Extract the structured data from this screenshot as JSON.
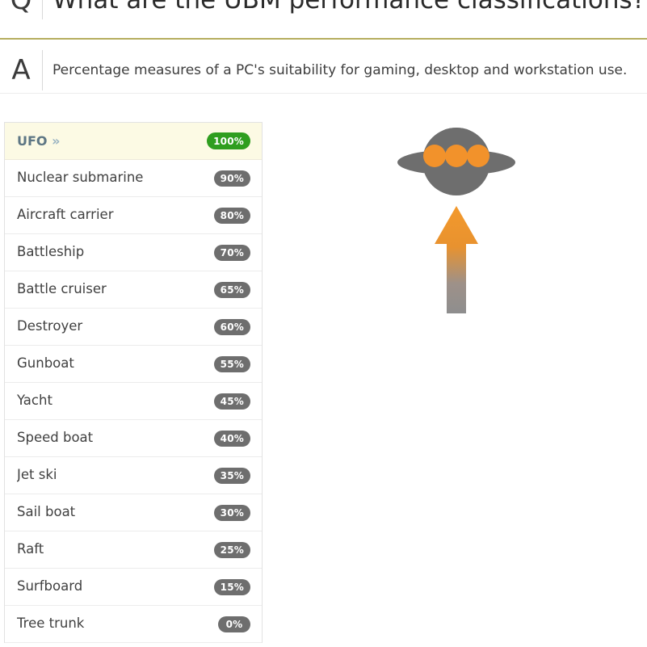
{
  "qa": {
    "question_marker": "Q",
    "question": "What are the UBM performance classifications?",
    "answer_marker": "A",
    "answer": "Percentage measures of a PC's suitability for gaming, desktop and workstation use."
  },
  "colors": {
    "gold_rule": "#b5ad5e",
    "gray_rule": "#ededed",
    "badge_gray": "#6e6e6e",
    "badge_green": "#2f9e1f",
    "highlight_bg": "#fcfae4",
    "highlight_text": "#5d7684",
    "ufo_body": "#6e6e6e",
    "ufo_light": "#f2922b",
    "arrow_top": "#f0982f",
    "arrow_bottom": "#8c8c8c"
  },
  "ranking": {
    "rows": [
      {
        "label": "UFO",
        "chevron": "»",
        "value": "100%",
        "highlight": true
      },
      {
        "label": "Nuclear submarine",
        "chevron": "",
        "value": "90%",
        "highlight": false
      },
      {
        "label": "Aircraft carrier",
        "chevron": "",
        "value": "80%",
        "highlight": false
      },
      {
        "label": "Battleship",
        "chevron": "",
        "value": "70%",
        "highlight": false
      },
      {
        "label": "Battle cruiser",
        "chevron": "",
        "value": "65%",
        "highlight": false
      },
      {
        "label": "Destroyer",
        "chevron": "",
        "value": "60%",
        "highlight": false
      },
      {
        "label": "Gunboat",
        "chevron": "",
        "value": "55%",
        "highlight": false
      },
      {
        "label": "Yacht",
        "chevron": "",
        "value": "45%",
        "highlight": false
      },
      {
        "label": "Speed boat",
        "chevron": "",
        "value": "40%",
        "highlight": false
      },
      {
        "label": "Jet ski",
        "chevron": "",
        "value": "35%",
        "highlight": false
      },
      {
        "label": "Sail boat",
        "chevron": "",
        "value": "30%",
        "highlight": false
      },
      {
        "label": "Raft",
        "chevron": "",
        "value": "25%",
        "highlight": false
      },
      {
        "label": "Surfboard",
        "chevron": "",
        "value": "15%",
        "highlight": false
      },
      {
        "label": "Tree trunk",
        "chevron": "",
        "value": "0%",
        "highlight": false
      }
    ]
  },
  "illustration": {
    "ufo_icon": "ufo-icon",
    "arrow_icon": "up-arrow-icon",
    "light_count": 3
  }
}
